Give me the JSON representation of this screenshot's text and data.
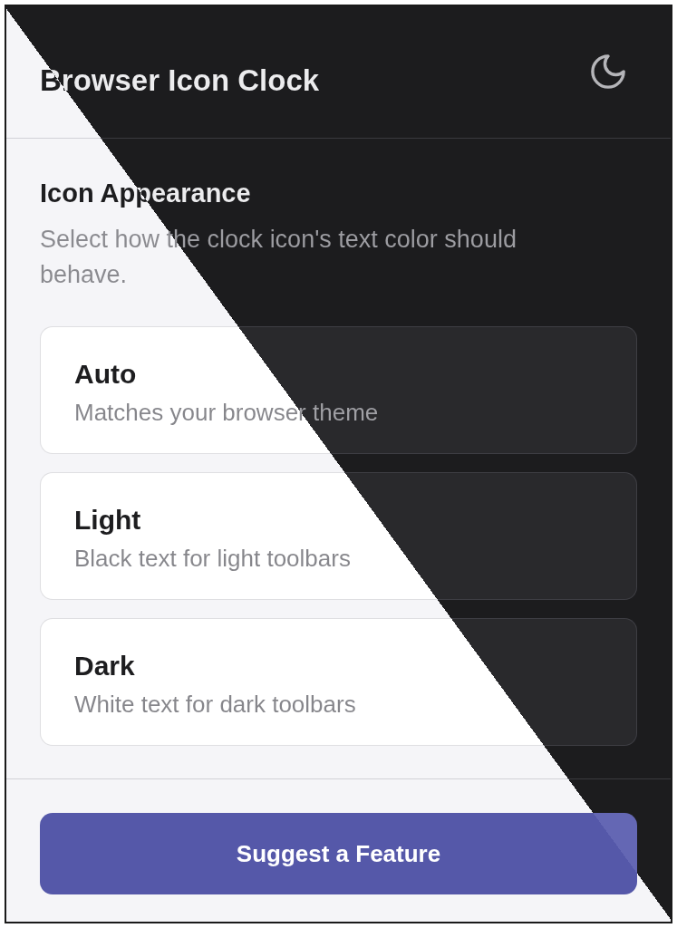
{
  "header": {
    "title": "Browser Icon Clock"
  },
  "section": {
    "heading": "Icon Appearance",
    "description": "Select how the clock icon's text color should behave.",
    "options": [
      {
        "title": "Auto",
        "description": "Matches your browser theme"
      },
      {
        "title": "Light",
        "description": "Black text for light toolbars"
      },
      {
        "title": "Dark",
        "description": "White text for dark toolbars"
      }
    ]
  },
  "footer": {
    "button": "Suggest a Feature"
  }
}
